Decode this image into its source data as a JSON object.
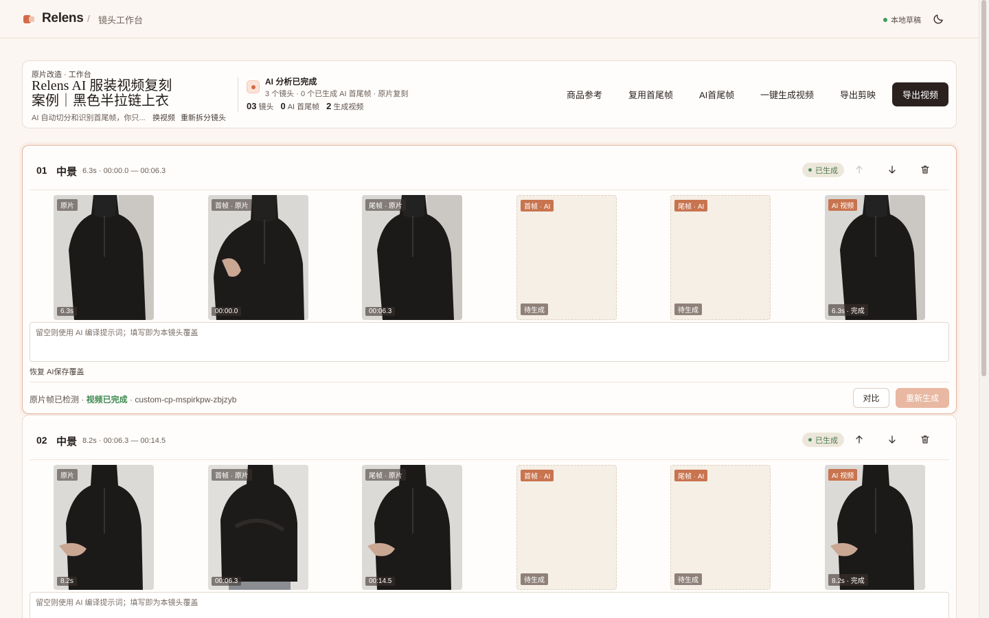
{
  "topbar": {
    "brand": "Relens",
    "separator": "/",
    "crumb": "镜头工作台",
    "draft_status": "本地草稿"
  },
  "header": {
    "eyebrow": "原片改造 · 工作台",
    "title": "Relens AI 服装视频复刻案例｜黑色半拉链上衣",
    "description": "AI 自动切分和识别首尾帧，你只...",
    "link_change_video": "换视频",
    "link_resplit": "重新拆分镜头",
    "analysis_title": "AI 分析已完成",
    "analysis_sub": "3 个镜头 · 0 个已生成 AI 首尾帧 · 原片复刻",
    "stats": [
      {
        "num": "03",
        "label": "镜头"
      },
      {
        "num": "0",
        "label": "AI 首尾帧"
      },
      {
        "num": "2",
        "label": "生成视频"
      }
    ],
    "nav": [
      "商品参考",
      "复用首尾帧",
      "AI首尾帧",
      "一键生成视频",
      "导出剪映"
    ],
    "export_label": "导出视频"
  },
  "shots": [
    {
      "num": "01",
      "type": "中景",
      "time": "6.3s · 00:00.0 — 00:06.3",
      "status": "已生成",
      "thumbs": [
        {
          "tag": "原片",
          "footer": "6.3s"
        },
        {
          "tag": "首帧 · 原片",
          "footer": "00:00.0"
        },
        {
          "tag": "尾帧 · 原片",
          "footer": "00:06.3"
        },
        {
          "tag": "首帧 · AI",
          "footer": "待生成"
        },
        {
          "tag": "尾帧 · AI",
          "footer": "待生成"
        },
        {
          "tag": "AI 视频",
          "footer": "6.3s · 完成"
        }
      ],
      "prompt_placeholder": "留空则使用 AI 编译提示词；填写即为本镜头覆盖",
      "restore_label": "恢复 AI保存覆盖",
      "footer_prefix": "原片帧已检测 · ",
      "footer_status": "视频已完成",
      "footer_suffix": " · custom-cp-mspirkpw-zbjzyb",
      "compare_label": "对比",
      "regen_label": "重新生成"
    },
    {
      "num": "02",
      "type": "中景",
      "time": "8.2s · 00:06.3 — 00:14.5",
      "status": "已生成",
      "thumbs": [
        {
          "tag": "原片",
          "footer": "8.2s"
        },
        {
          "tag": "首帧 · 原片",
          "footer": "00:06.3"
        },
        {
          "tag": "尾帧 · 原片",
          "footer": "00:14.5"
        },
        {
          "tag": "首帧 · AI",
          "footer": "待生成"
        },
        {
          "tag": "尾帧 · AI",
          "footer": "待生成"
        },
        {
          "tag": "AI 视频",
          "footer": "8.2s · 完成"
        }
      ],
      "prompt_placeholder": "留空则使用 AI 编译提示词；填写即为本镜头覆盖"
    }
  ]
}
